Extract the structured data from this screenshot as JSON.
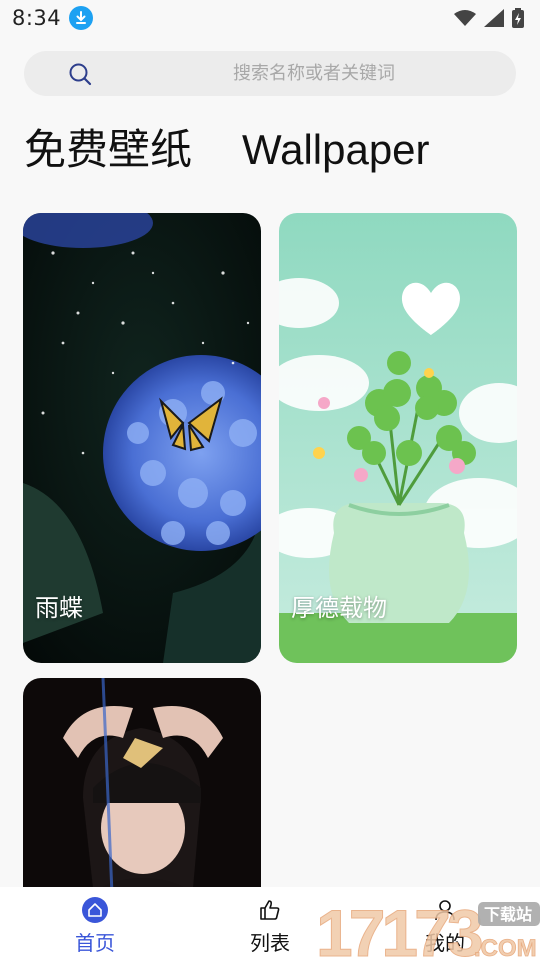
{
  "status_bar": {
    "time": "8:34",
    "icons": [
      "download-badge-icon",
      "wifi-icon",
      "signal-icon",
      "battery-charging-icon"
    ]
  },
  "search": {
    "placeholder": "搜索名称或者关键词",
    "icon": "search-icon"
  },
  "header": {
    "title_cn": "免费壁纸",
    "title_en": "Wallpaper",
    "accent_color": "#5a6fe6"
  },
  "wallpapers": [
    {
      "label": "雨蝶"
    },
    {
      "label": "厚德载物"
    },
    {
      "label": ""
    }
  ],
  "tabbar": {
    "tabs": [
      {
        "label": "首页",
        "icon": "home-icon",
        "active": true
      },
      {
        "label": "列表",
        "icon": "thumbs-up-icon",
        "active": false
      },
      {
        "label": "我的",
        "icon": "user-icon",
        "active": false
      }
    ],
    "active_color": "#3a56d9"
  },
  "watermark": {
    "text": "17173",
    "tag": "下载站",
    "suffix": ".COM"
  }
}
